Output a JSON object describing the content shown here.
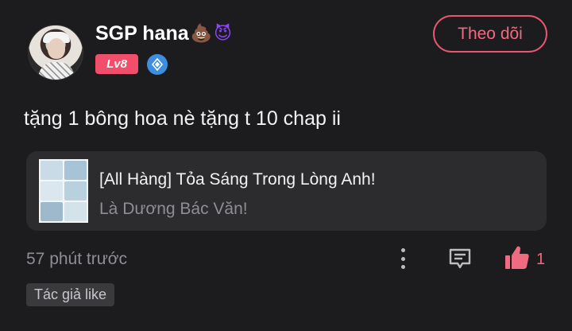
{
  "user": {
    "name": "SGP hana",
    "emoji_1": "💩",
    "emoji_2": "😈",
    "level_badge": "Lv8",
    "follow_label": "Theo dõi"
  },
  "comment": {
    "text": "tặng 1 bông hoa nè tặng t 10 chap ii"
  },
  "linked_story": {
    "title": "[All Hàng] Tỏa Sáng Trong Lòng Anh!",
    "subtitle": "Là Dương Bác Văn!"
  },
  "footer": {
    "timestamp": "57 phút trước",
    "like_count": "1",
    "author_like_tag": "Tác giả like"
  },
  "colors": {
    "background": "#1c1c1e",
    "accent": "#f06a80",
    "level_badge": "#f04e6a",
    "vip_icon": "#3e8ee0",
    "card_bg": "#2c2c2e"
  },
  "icons": [
    "avatar",
    "vip-diamond-icon",
    "more-vertical-icon",
    "reply-comment-icon",
    "thumbs-up-icon"
  ]
}
